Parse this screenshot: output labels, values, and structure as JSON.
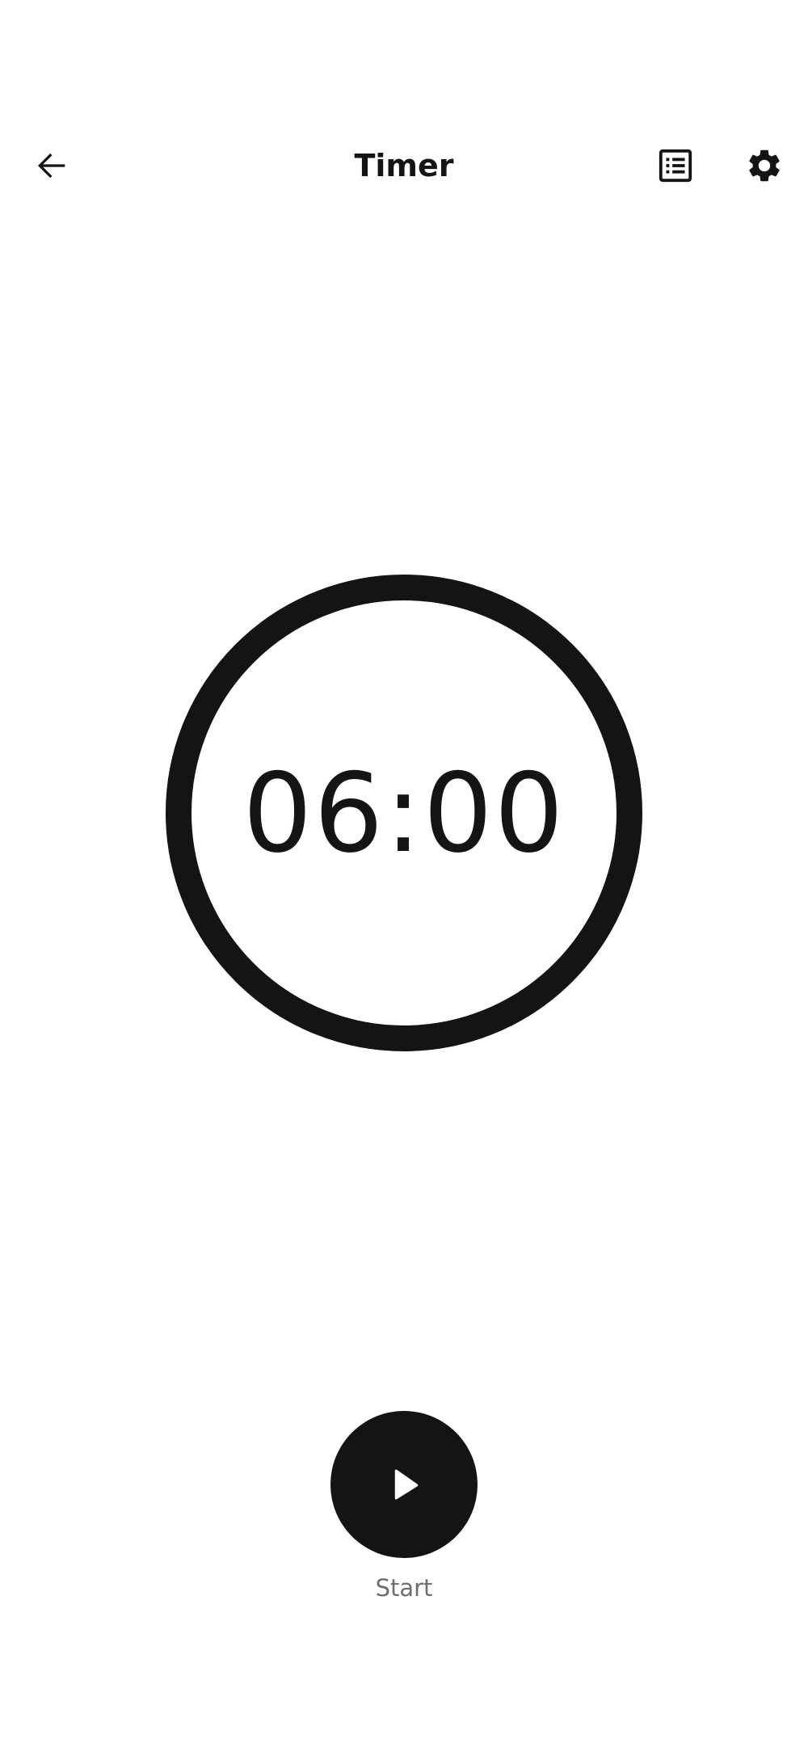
{
  "header": {
    "title": "Timer",
    "back_icon": "arrow-left-icon",
    "history_icon": "list-icon",
    "settings_icon": "gear-icon"
  },
  "timer": {
    "display": "06:00",
    "progress": 1.0
  },
  "controls": {
    "start_label": "Start",
    "start_icon": "play-icon"
  },
  "colors": {
    "primary": "#141414",
    "background": "#ffffff",
    "label": "#6e6e6e"
  }
}
